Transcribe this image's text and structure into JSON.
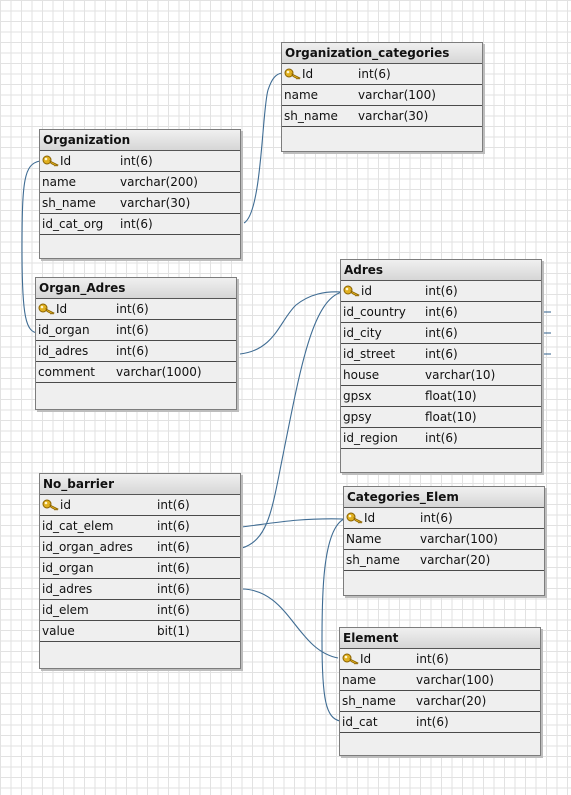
{
  "tables": {
    "organization_categories": {
      "title": "Organization_categories",
      "columns": [
        {
          "name": "Id",
          "type": "int(6)",
          "pk": true
        },
        {
          "name": "name",
          "type": "varchar(100)"
        },
        {
          "name": "sh_name",
          "type": "varchar(30)"
        }
      ]
    },
    "organization": {
      "title": "Organization",
      "columns": [
        {
          "name": "Id",
          "type": "int(6)",
          "pk": true
        },
        {
          "name": "name",
          "type": "varchar(200)"
        },
        {
          "name": "sh_name",
          "type": "varchar(30)"
        },
        {
          "name": "id_cat_org",
          "type": "int(6)"
        }
      ]
    },
    "organ_adres": {
      "title": "Organ_Adres",
      "columns": [
        {
          "name": "Id",
          "type": "int(6)",
          "pk": true
        },
        {
          "name": "id_organ",
          "type": "int(6)"
        },
        {
          "name": "id_adres",
          "type": "int(6)"
        },
        {
          "name": "comment",
          "type": "varchar(1000)"
        }
      ]
    },
    "adres": {
      "title": "Adres",
      "columns": [
        {
          "name": "id",
          "type": "int(6)",
          "pk": true
        },
        {
          "name": "id_country",
          "type": "int(6)"
        },
        {
          "name": "id_city",
          "type": "int(6)"
        },
        {
          "name": "id_street",
          "type": "int(6)"
        },
        {
          "name": "house",
          "type": "varchar(10)"
        },
        {
          "name": "gpsx",
          "type": "float(10)"
        },
        {
          "name": "gpsy",
          "type": "float(10)"
        },
        {
          "name": "id_region",
          "type": "int(6)"
        }
      ]
    },
    "no_barrier": {
      "title": "No_barrier",
      "columns": [
        {
          "name": "id",
          "type": "int(6)",
          "pk": true
        },
        {
          "name": "id_cat_elem",
          "type": "int(6)"
        },
        {
          "name": "id_organ_adres",
          "type": "int(6)"
        },
        {
          "name": "id_organ",
          "type": "int(6)"
        },
        {
          "name": "id_adres",
          "type": "int(6)"
        },
        {
          "name": "id_elem",
          "type": "int(6)"
        },
        {
          "name": "value",
          "type": "bit(1)"
        }
      ]
    },
    "categories_elem": {
      "title": "Categories_Elem",
      "columns": [
        {
          "name": "Id",
          "type": "int(6)",
          "pk": true
        },
        {
          "name": "Name",
          "type": "varchar(100)"
        },
        {
          "name": "sh_name",
          "type": "varchar(20)"
        }
      ]
    },
    "element": {
      "title": "Element",
      "columns": [
        {
          "name": "Id",
          "type": "int(6)",
          "pk": true
        },
        {
          "name": "name",
          "type": "varchar(100)"
        },
        {
          "name": "sh_name",
          "type": "varchar(20)"
        },
        {
          "name": "id_cat",
          "type": "int(6)"
        }
      ]
    }
  },
  "colors": {
    "header_bg": "#d9d9d9",
    "table_bg": "#efefef",
    "relation_line": "#3f6c93",
    "key_icon": "#e0b020"
  },
  "icons": {
    "primary_key": "key-icon"
  }
}
